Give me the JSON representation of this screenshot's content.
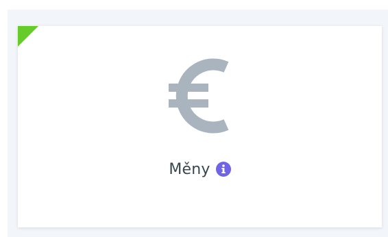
{
  "card": {
    "title": "Měny",
    "icon": "euro-icon",
    "info_icon": "info-icon",
    "colors": {
      "corner_badge": "#67cc2a",
      "euro_icon": "#a9b4bf",
      "info_icon": "#6f63e6",
      "title_text": "#37474f",
      "background": "#f2f5f9"
    }
  }
}
